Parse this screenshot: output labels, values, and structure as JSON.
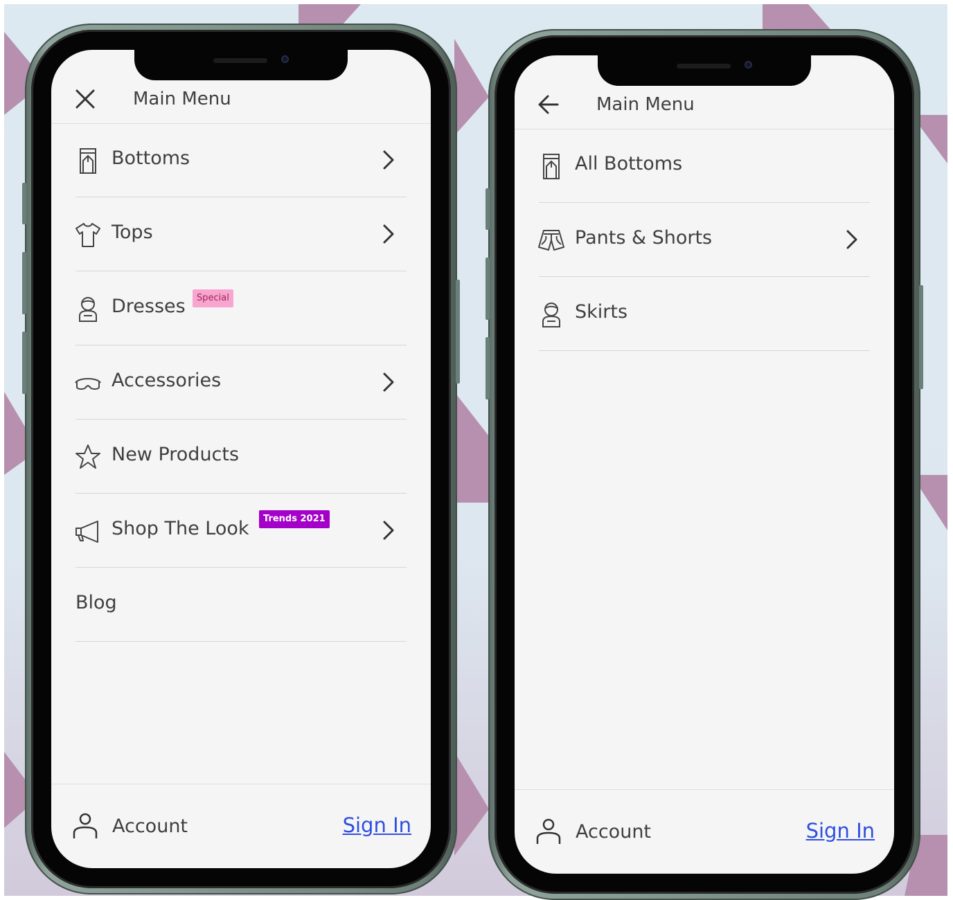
{
  "colors": {
    "badge_pink": "#f8a6cf",
    "badge_purple": "#a300c9",
    "link_blue": "#2f4fe0"
  },
  "left_screen": {
    "header": {
      "close_icon": "close-icon",
      "title": "Main Menu"
    },
    "items": [
      {
        "label": "Bottoms",
        "icon": "pants-icon",
        "has_chevron": true
      },
      {
        "label": "Tops",
        "icon": "tshirt-icon",
        "has_chevron": true
      },
      {
        "label": "Dresses",
        "icon": "dress-icon",
        "has_chevron": false,
        "badge": "Special"
      },
      {
        "label": "Accessories",
        "icon": "sunglasses-icon",
        "has_chevron": true
      },
      {
        "label": "New Products",
        "icon": "star-icon",
        "has_chevron": false
      },
      {
        "label": "Shop The Look",
        "icon": "megaphone-icon",
        "has_chevron": true,
        "badge": "Trends 2021"
      },
      {
        "label": "Blog",
        "has_chevron": false
      }
    ],
    "footer": {
      "account_label": "Account",
      "signin_label": "Sign In"
    }
  },
  "right_screen": {
    "header": {
      "back_icon": "arrow-left-icon",
      "title": "Main Menu"
    },
    "items": [
      {
        "label": "All Bottoms",
        "icon": "pants-icon",
        "has_chevron": false
      },
      {
        "label": "Pants & Shorts",
        "icon": "shorts-icon",
        "has_chevron": true
      },
      {
        "label": "Skirts",
        "icon": "dress-icon",
        "has_chevron": false
      }
    ],
    "footer": {
      "account_label": "Account",
      "signin_label": "Sign In"
    }
  }
}
